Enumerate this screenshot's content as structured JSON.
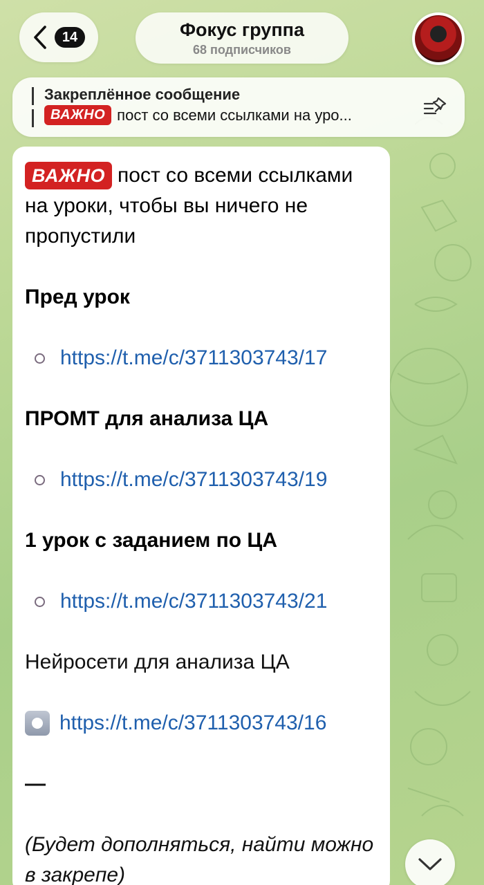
{
  "header": {
    "back_count": "14",
    "title": "Фокус группа",
    "subtitle": "68 подписчиков"
  },
  "pinned": {
    "label": "Закреплённое сообщение",
    "tag": "ВАЖНО",
    "preview": "пост со всеми ссылками на уро..."
  },
  "message": {
    "tag": "ВАЖНО",
    "intro": "пост со всеми ссылками на уроки, чтобы вы ничего не пропустили",
    "sections": [
      {
        "heading": "Пред урок",
        "link": "https://t.me/c/3711303743/17"
      },
      {
        "heading": "ПРОМТ для анализа ЦА",
        "link": "https://t.me/c/3711303743/19"
      },
      {
        "heading": "1 урок с заданием по ЦА",
        "link": "https://t.me/c/3711303743/21"
      }
    ],
    "plain_heading": "Нейросети для анализа ЦА",
    "plain_link": "https://t.me/c/3711303743/16",
    "dash": "—",
    "footer": "(Будет дополняться, найти можно в закрепе)"
  },
  "colors": {
    "accent_link": "#1f5fad",
    "tag_red": "#d32222"
  },
  "icons": [
    "chevron-left-icon",
    "pin-list-icon",
    "chevron-down-icon",
    "radio-circle-icon",
    "record-button-icon"
  ]
}
